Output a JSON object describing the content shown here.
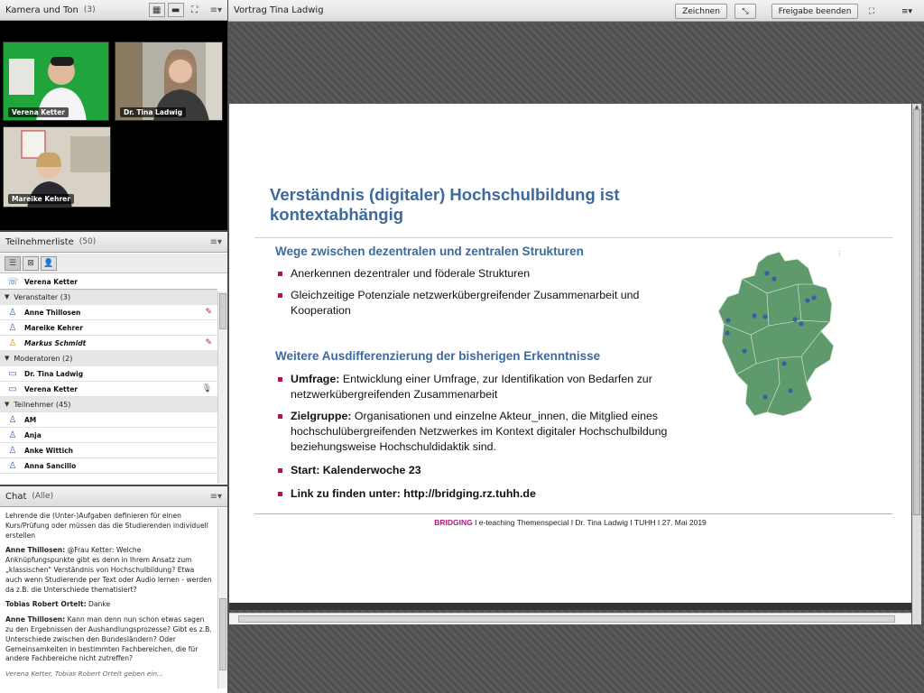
{
  "camera_pod": {
    "title": "Kamera und Ton",
    "count": "(3)",
    "videos": [
      {
        "name": "Verena Ketter"
      },
      {
        "name": "Dr. Tina Ladwig"
      },
      {
        "name": "Mareike Kehrer"
      }
    ]
  },
  "participants_pod": {
    "title": "Teilnehmerliste",
    "count": "(50)",
    "speaker": "Verena Ketter",
    "groups": [
      {
        "label": "Veranstalter (3)",
        "members": [
          {
            "name": "Anne Thillosen",
            "icon": "user-icon",
            "mic_off": true
          },
          {
            "name": "Mareike Kehrer",
            "icon": "user-icon",
            "mic_off": false
          },
          {
            "name": "Markus Schmidt",
            "icon": "user-icon",
            "mic_off": true,
            "italic": true
          }
        ]
      },
      {
        "label": "Moderatoren (2)",
        "members": [
          {
            "name": "Dr. Tina Ladwig",
            "icon": "presenter-icon"
          },
          {
            "name": "Verena Ketter",
            "icon": "presenter-icon",
            "speaking": true
          }
        ]
      },
      {
        "label": "Teilnehmer (45)",
        "members": [
          {
            "name": "AM",
            "icon": "user-icon"
          },
          {
            "name": "Anja",
            "icon": "user-icon"
          },
          {
            "name": "Anke Wittich",
            "icon": "user-icon"
          },
          {
            "name": "Anna Sancillo",
            "icon": "user-icon"
          }
        ]
      }
    ]
  },
  "chat_pod": {
    "title": "Chat",
    "scope": "(Alle)",
    "messages": [
      {
        "sender": "",
        "text": "Lehrende die (Unter-)Aufgaben definieren für einen Kurs/Prüfung oder müssen das die Studierenden individuell erstellen"
      },
      {
        "sender": "Anne Thillosen:",
        "text": " @Frau Ketter: Welche Anknüpfungspunkte gibt es denn in Ihrem Ansatz zum „klassischen\" Verständnis von Hochschulbildung? Etwa auch wenn Studierende per Text oder Audio lernen - werden da z.B. die Unterschiede thematisiert?"
      },
      {
        "sender": "Tobias Robert Ortelt:",
        "text": " Danke"
      },
      {
        "sender": "Anne Thillosen:",
        "text": " Kann man denn nun schon etwas sagen zu den Ergebnissen der Aushandlungsprozesse? Gibt es z.B. Unterschiede zwischen den Bundesländern? Oder Gemeinsamkeiten in bestimmten Fachbereichen, die für andere Fachbereiche nicht zutreffen?"
      }
    ],
    "typing": "Verena Ketter, Tobias Robert Ortelt geben ein..."
  },
  "share_pod": {
    "title": "Vortrag Tina Ladwig",
    "draw_label": "Zeichnen",
    "stop_share_label": "Freigabe beenden"
  },
  "slide": {
    "title": "Verständnis (digitaler) Hochschulbildung ist kontextabhängig",
    "section1": "Wege zwischen dezentralen und zentralen Strukturen",
    "bullets1": [
      "Anerkennen dezentraler und föderale Strukturen",
      "Gleichzeitige Potenziale netzwerkübergreifender Zusammenarbeit und Kooperation"
    ],
    "section2": "Weitere Ausdifferenzierung der bisherigen Erkenntnisse",
    "bullets2": [
      {
        "bold": "Umfrage:",
        "text": " Entwicklung einer Umfrage, zur Identifikation von Bedarfen zur netzwerkübergreifenden Zusammenarbeit"
      },
      {
        "bold": "Zielgruppe:",
        "text": " Organisationen und einzelne Akteur_innen, die Mitglied eines hochschulübergreifenden Netzwerkes im Kontext digitaler Hochschulbildung beziehungsweise Hochschuldidaktik sind."
      },
      {
        "bold": "Start: Kalenderwoche 23",
        "text": ""
      },
      {
        "bold": "Link zu finden unter: http://bridging.rz.tuhh.de",
        "text": ""
      }
    ],
    "footer_brand": "BRIDGING",
    "footer_text": " I e-teaching Themenspecial I Dr. Tina Ladwig I TUHH I 27. Mai 2019",
    "map_color": "#5f9a6c",
    "accent": "#3d6a9a"
  }
}
